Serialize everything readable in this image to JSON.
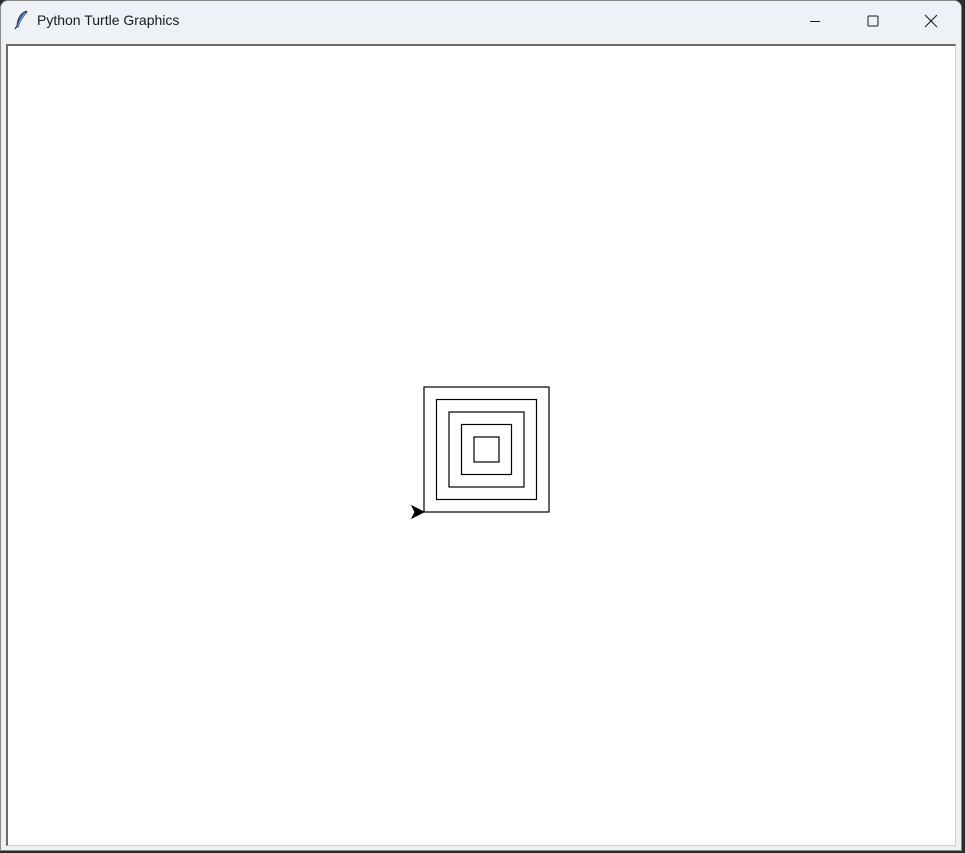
{
  "window": {
    "title": "Python Turtle Graphics",
    "app_icon": "feather-icon",
    "controls": {
      "minimize_icon": "minimize-icon",
      "maximize_icon": "maximize-icon",
      "close_icon": "close-icon"
    }
  },
  "canvas": {
    "background": "#ffffff",
    "pen_color": "#000000",
    "drawing": "concentric-squares",
    "square_count": 5,
    "turtle_icon": "turtle-arrow-icon",
    "turtle_heading": "east"
  }
}
